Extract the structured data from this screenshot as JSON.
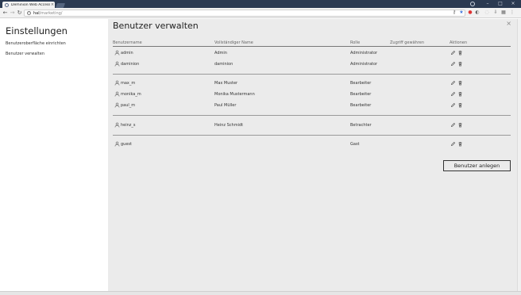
{
  "browser": {
    "tab_title": "Deminion Web Access",
    "tab_close": "×",
    "url_host": "hal",
    "url_path": "/marketing/",
    "window_controls": [
      "–",
      "□",
      "×"
    ]
  },
  "sidebar": {
    "title": "Einstellungen",
    "items": [
      {
        "label": "Benutzeroberfläche einrichten"
      },
      {
        "label": "Benutzer verwalten"
      }
    ]
  },
  "main": {
    "title": "Benutzer verwalten",
    "close_label": "×",
    "columns": [
      "Benutzername",
      "Vollständiger Name",
      "Rolle",
      "Zugriff gewähren",
      "Aktionen"
    ],
    "users": [
      {
        "username": "admin",
        "full_name": "Admin",
        "role": "Administrator"
      },
      {
        "username": "daminion",
        "full_name": "daminion",
        "role": "Administrator"
      },
      {
        "username": "max_m",
        "full_name": "Max Muster",
        "role": "Bearbeiter"
      },
      {
        "username": "monika_m",
        "full_name": "Monika Mustermann",
        "role": "Bearbeiter"
      },
      {
        "username": "paul_m",
        "full_name": "Paul Müller",
        "role": "Bearbeiter"
      },
      {
        "username": "heinz_s",
        "full_name": "Heinz Schmidt",
        "role": "Betrachter"
      },
      {
        "username": "guest",
        "full_name": "",
        "role": "Gast"
      }
    ],
    "add_button": "Benutzer anlegen"
  },
  "icons": {
    "user": "user-icon",
    "edit": "pencil-icon",
    "delete": "trash-icon"
  }
}
